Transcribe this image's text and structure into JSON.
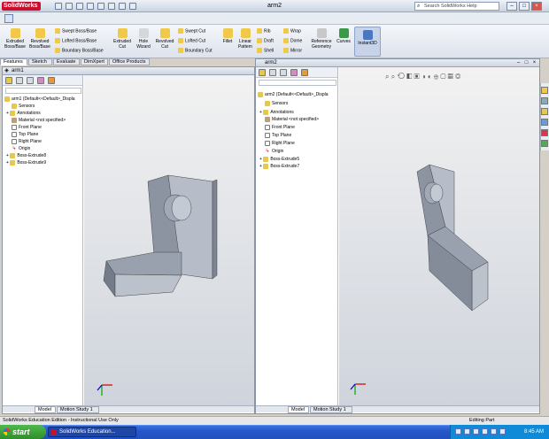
{
  "app": {
    "logo": "SolidWorks",
    "window_title": "arm2",
    "search_placeholder": "Search SolidWorks Help"
  },
  "window_buttons": [
    "–",
    "□",
    "×"
  ],
  "command_manager": {
    "large_buttons": [
      {
        "label": "Extruded Boss/Base",
        "color": "#f0c94a"
      },
      {
        "label": "Revolved Boss/Base",
        "color": "#f0c94a"
      },
      {
        "label": "Extruded Cut",
        "color": "#f0c94a"
      },
      {
        "label": "Hole Wizard",
        "color": "#d5d7da"
      },
      {
        "label": "Revolved Cut",
        "color": "#f0c94a"
      },
      {
        "label": "Fillet",
        "color": "#f0c94a"
      },
      {
        "label": "Linear Pattern",
        "color": "#f0c94a"
      },
      {
        "label": "Reference Geometry",
        "color": "#c8c8c8"
      },
      {
        "label": "Curves",
        "color": "#3a9a4a"
      },
      {
        "label": "Instant3D",
        "color": "#4a78c0"
      }
    ],
    "small_buttons_col1": [
      "Swept Boss/Base",
      "Lofted Boss/Base",
      "Boundary Boss/Base"
    ],
    "small_buttons_col2": [
      "Swept Cut",
      "Lofted Cut",
      "Boundary Cut"
    ],
    "small_buttons_col3": [
      "Rib",
      "Draft",
      "Shell"
    ],
    "small_buttons_col4": [
      "Wrap",
      "Dome",
      "Mirror"
    ],
    "tabs": [
      "Features",
      "Sketch",
      "Evaluate",
      "DimXpert",
      "Office Products"
    ]
  },
  "doc1": {
    "title": "arm1",
    "tree": [
      "arm1 (Default<<Default>_Displa",
      "Sensors",
      "Annotations",
      "Material <not specified>",
      "Front Plane",
      "Top Plane",
      "Right Plane",
      "Origin",
      "Boss-Extrude8",
      "Boss-Extrude9"
    ],
    "bottom_tabs": [
      "Model",
      "Motion Study 1"
    ]
  },
  "doc2": {
    "title": "arm2",
    "tree": [
      "arm2 (Default<<Default>_Displa",
      "Sensors",
      "Annotations",
      "Material <not specified>",
      "Front Plane",
      "Top Plane",
      "Right Plane",
      "Origin",
      "Boss-Extrude5",
      "Boss-Extrude7"
    ],
    "bottom_tabs": [
      "Model",
      "Motion Study 1"
    ]
  },
  "status": {
    "left": "SolidWorks Education Edition - Instructional Use Only",
    "right": "Editing Part"
  },
  "taskbar": {
    "start": "start",
    "task": "SolidWorks Education...",
    "clock": "8:45 AM"
  },
  "colors": {
    "part_face_light": "#b7bdc8",
    "part_face_dark": "#8c93a1",
    "taskbar_blue": "#2657c8"
  }
}
